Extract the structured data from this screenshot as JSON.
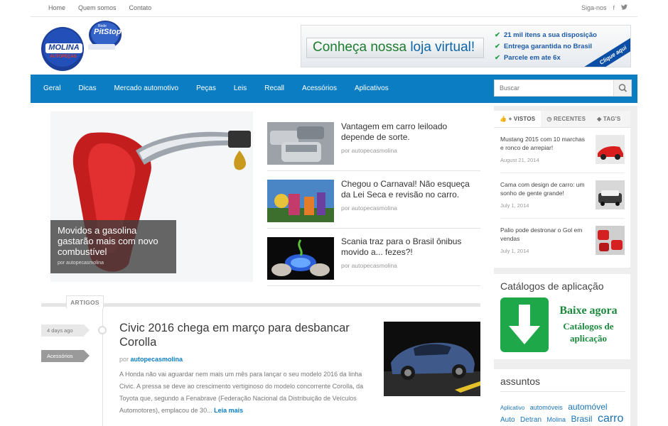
{
  "topbar": {
    "links": [
      "Home",
      "Quem somos",
      "Contato"
    ],
    "follow_label": "Siga-nos",
    "facebook_icon": "f",
    "twitter_icon": "t"
  },
  "logo": {
    "main": "MOLINA",
    "sub": "AUTOPEÇAS",
    "badge_top": "Rede",
    "badge": "PitStop"
  },
  "banner": {
    "headline_a": "Conheça nossa ",
    "headline_b": "loja virtual!",
    "checks": [
      "21 mil itens a sua disposição",
      "Entrega garantida no Brasil",
      "Parcele em ate 6x"
    ],
    "ribbon": "Clique aqui"
  },
  "nav": {
    "items": [
      "Geral",
      "Dicas",
      "Mercado automotivo",
      "Peças",
      "Leis",
      "Recall",
      "Acessórios",
      "Aplicativos"
    ],
    "search_placeholder": "Buscar"
  },
  "featured": {
    "title": "Movidos a gasolina gastarão mais com novo combustível",
    "by": "por autopecasmolina"
  },
  "side_posts": [
    {
      "title": "Vantagem em carro leiloado depende de sorte.",
      "by": "por autopecasmolina"
    },
    {
      "title": "Chegou o Carnaval! Não esqueça da Lei Seca e revisão no carro.",
      "by": "por autopecasmolina"
    },
    {
      "title": "Scania traz para o Brasil ônibus movido a... fezes?!",
      "by": "por autopecasmolina"
    }
  ],
  "section": {
    "label": "ARTIGOS"
  },
  "article": {
    "time": "4 days ago",
    "category": "Acessórios",
    "title": "Civic 2016 chega em março para desbancar Corolla",
    "by_prefix": "por ",
    "author": "autopecasmolina",
    "excerpt": "A Honda não vai aguardar nem mais um mês para lançar o seu modelo 2016 da linha Civic. A pressa se deve ao crescimento vertiginoso do modelo concorrente Corolla, da Toyota que, segundo a Fenabrave (Federação Nacional da Distribuição de Veículos Automotores), emplacou de 30...",
    "more": "Leia mais"
  },
  "sidebar": {
    "tabs": [
      "+ VISTOS",
      "RECENTES",
      "TAG'S"
    ],
    "popular": [
      {
        "title": "Mustang 2015 com 10 marchas e ronco de arrepiar!",
        "date": "August 21, 2014"
      },
      {
        "title": "Cama com design de carro: um sonho de gente grande!",
        "date": "July 1, 2014"
      },
      {
        "title": "Palio pode destronar o Gol em vendas",
        "date": "July 1, 2014"
      }
    ],
    "catalog_heading": "Catálogos de aplicação",
    "catalog_line1": "Baixe agora",
    "catalog_line2": "Catálogos de",
    "catalog_line3": "aplicação",
    "subjects_heading": "assuntos",
    "tags": [
      "Aplicativo",
      "automóveis",
      "automóvel",
      "Auto",
      "Detran",
      "Molina",
      "Brasil",
      "carro"
    ]
  },
  "colors": {
    "nav_blue": "#0b7ec3",
    "link_blue": "#0b7ec3",
    "banner_green": "#1c7d2e",
    "catalog_green": "#1ea84a"
  }
}
